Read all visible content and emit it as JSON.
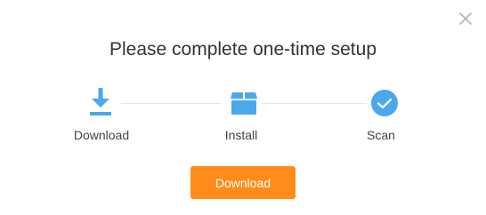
{
  "dialog": {
    "title": "Please complete one-time setup",
    "close_icon": "close-icon"
  },
  "steps": [
    {
      "label": "Download",
      "icon": "download-icon"
    },
    {
      "label": "Install",
      "icon": "package-box-icon"
    },
    {
      "label": "Scan",
      "icon": "checkmark-circle-icon"
    }
  ],
  "actions": {
    "primary_label": "Download"
  },
  "colors": {
    "accent_blue": "#4aa8ec",
    "button_orange": "#ff8c1a",
    "text_dark": "#333333",
    "text_muted": "#444444",
    "connector_line": "#e6e6e6",
    "close_icon": "#b3b3b3"
  }
}
